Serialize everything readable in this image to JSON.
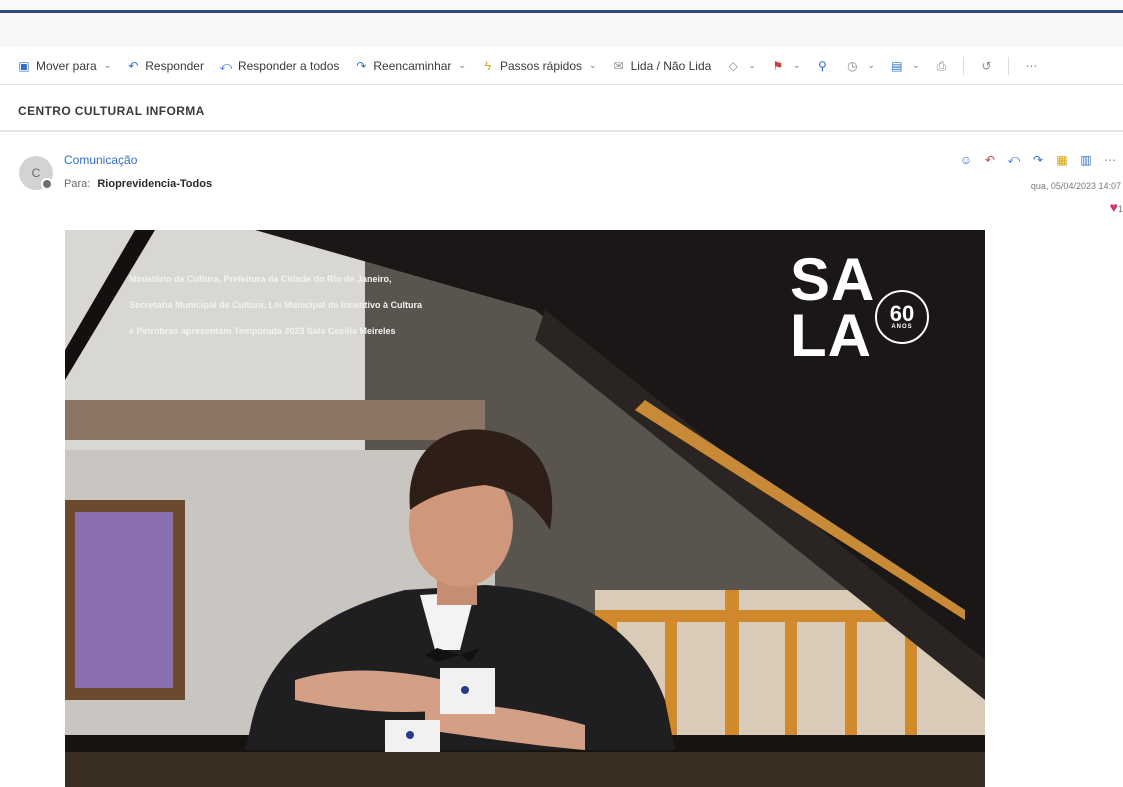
{
  "toolbar": {
    "items": [
      {
        "label": "Mover para",
        "icon": "folder-move-icon",
        "dropdown": true
      },
      {
        "label": "Responder",
        "icon": "reply-icon",
        "dropdown": false
      },
      {
        "label": "Responder a todos",
        "icon": "reply-all-icon",
        "dropdown": false
      },
      {
        "label": "Reencaminhar",
        "icon": "forward-icon",
        "dropdown": true
      },
      {
        "label": "Passos rápidos",
        "icon": "lightning-icon",
        "dropdown": true
      },
      {
        "label": "Lida / Não Lida",
        "icon": "envelope-icon",
        "dropdown": false
      }
    ],
    "icon_buttons": [
      "tag-icon",
      "flag-icon",
      "pin-icon",
      "clock-icon",
      "move-icon",
      "print-icon",
      "undo-icon",
      "more-icon"
    ]
  },
  "message": {
    "subject": "CENTRO CULTURAL INFORMA",
    "avatar_initial": "C",
    "sender": "Comunicação",
    "to_label": "Para:",
    "to_name": "Rioprevidencia-Todos",
    "date": "qua, 05/04/2023 14:07",
    "reaction": {
      "icon": "heart-icon",
      "count": "1"
    }
  },
  "poster": {
    "lines": [
      "Ministério da Cultura, Prefeitura da Cidade do Rio de Janeiro,",
      "Secretaria Municipal de Cultura, Lei Municipal de Incentivo à Cultura",
      "e Petrobras apresentam Temporada 2023 Sala Cecília Meireles"
    ],
    "logo_top": "SA",
    "logo_bottom": "LA",
    "badge_number": "60",
    "badge_text": "ANOS"
  },
  "colors": {
    "accent": "#2f6fd1",
    "topline": "#2e4d7a",
    "reaction": "#d6336c"
  }
}
